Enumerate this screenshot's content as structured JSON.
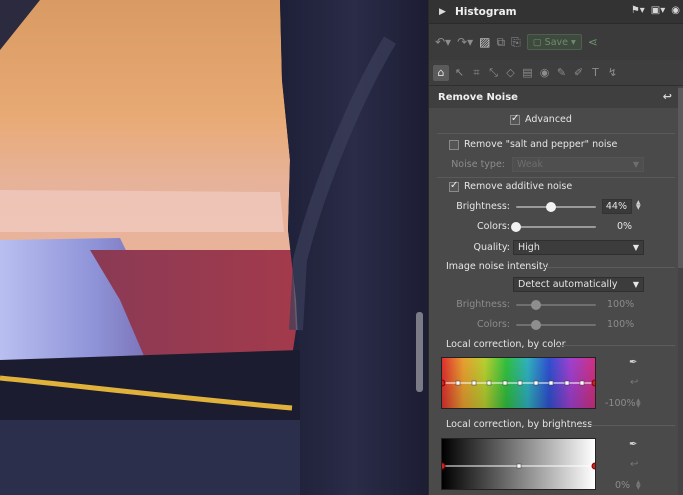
{
  "histogram": {
    "title": "Histogram"
  },
  "toolbar": {
    "save_label": "Save"
  },
  "section": {
    "title": "Remove Noise"
  },
  "advanced": {
    "label": "Advanced",
    "checked": true
  },
  "salt_pepper": {
    "label": "Remove \"salt and pepper\" noise",
    "checked": false
  },
  "noise_type": {
    "label": "Noise type:",
    "value": "Weak"
  },
  "additive": {
    "label": "Remove additive noise",
    "checked": true
  },
  "brightness": {
    "label": "Brightness:",
    "value": "44%",
    "level": 0.44
  },
  "colors": {
    "label": "Colors:",
    "value": "0%",
    "level": 0.0
  },
  "quality": {
    "label": "Quality:",
    "value": "High"
  },
  "intensity": {
    "title": "Image noise intensity",
    "mode": "Detect automatically",
    "brightness": {
      "label": "Brightness:",
      "value": "100%",
      "level": 0.25
    },
    "colors": {
      "label": "Colors:",
      "value": "100%",
      "level": 0.25
    }
  },
  "local_color": {
    "title": "Local correction, by color",
    "value": "-100%"
  },
  "local_brightness": {
    "title": "Local correction, by brightness",
    "value": "0%"
  },
  "colors_map": {
    "accent": "#ffffff",
    "panel": "#4a4a4a",
    "header": "#333333"
  },
  "icons": [
    "caret-right-icon",
    "pin-icon",
    "monitor-icon",
    "circle-icon",
    "undo-icon",
    "redo-icon",
    "image-icon",
    "copy-icon",
    "save-icon",
    "share-icon",
    "home-icon",
    "pointer-icon",
    "crop-icon",
    "eyedropper-icon"
  ]
}
